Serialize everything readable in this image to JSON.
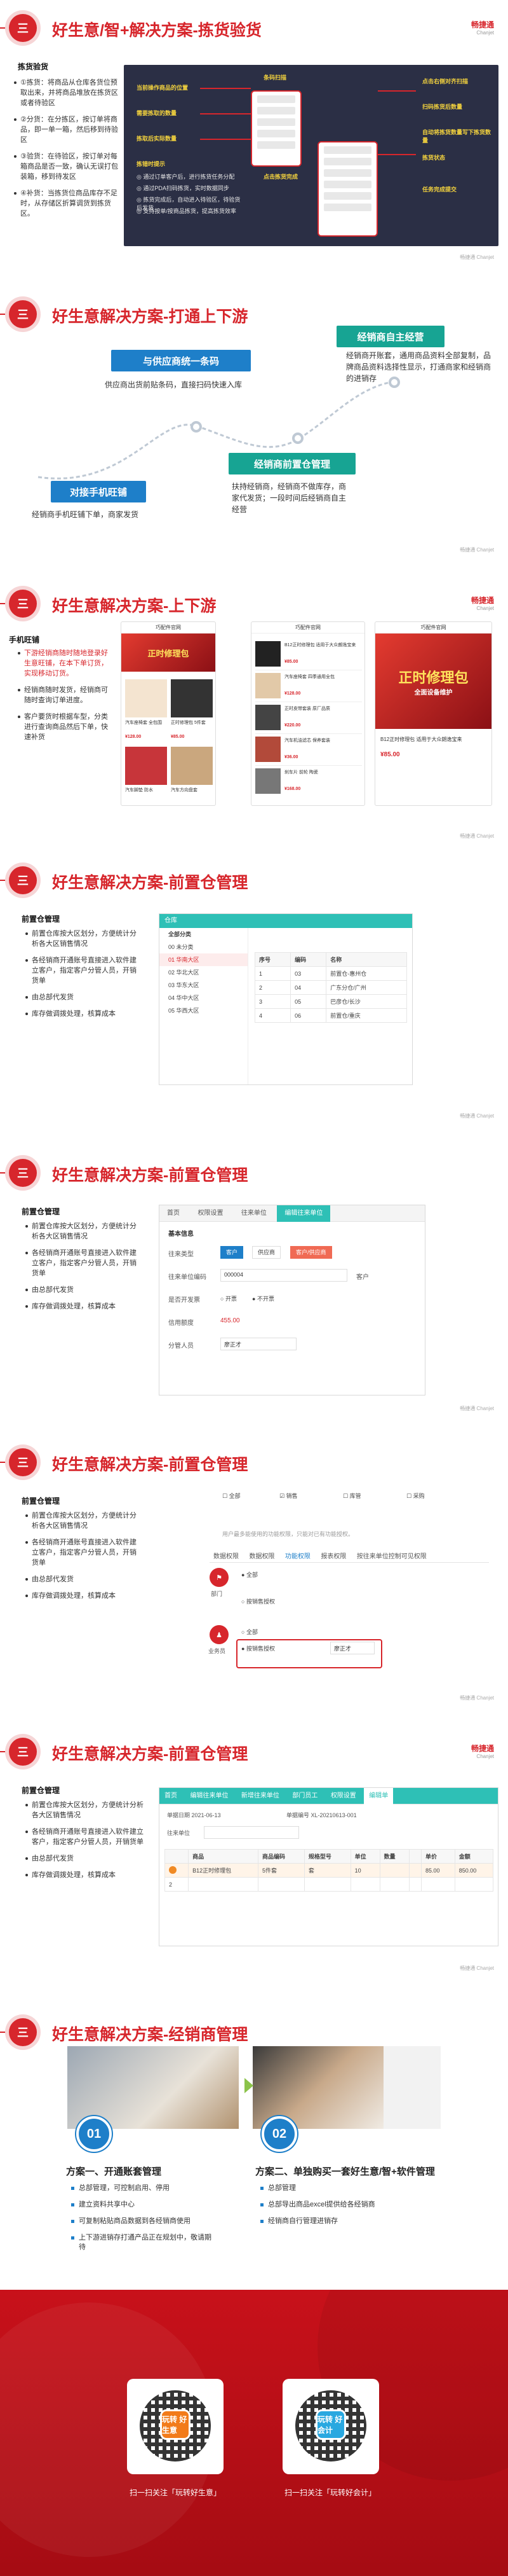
{
  "brand": {
    "cn": "畅捷通",
    "en": "Chanjet"
  },
  "footer": "畅捷通 Chanjet",
  "slide1": {
    "num": "三",
    "title": "好生意/智+解决方案-拣货验货",
    "section": "拣货验货",
    "steps": [
      "①拣货：将商品从仓库各货位预取出来，并将商品堆放在拣货区或者待验区",
      "②分货：在分拣区，按订单将商品，即一单一箱，然后移到待验区",
      "③验货：在待验区，按订单对每箱商品是否一致，确认无误打包装箱，移到待发区",
      "④补货：当拣货位商品库存不足时，从存储区折算调货到拣货区。"
    ],
    "notes": [
      "当前操作商品的位置",
      "需要拣取的数量",
      "拣取后实际数量",
      "拣错时提示",
      "条码扫描",
      "点击拣货完成",
      "点击右侧对齐扫描",
      "扫码拣货后数量",
      "自动将拣货数量写下拣货数量",
      "拣货状态",
      "任务完成提交"
    ],
    "board_paragraphs": [
      "◎ 通过订单客户后，进行拣货任务分配",
      "◎ 通过PDA扫码拣货，实时数据同步",
      "◎ 拣货完成后，自动进入待验区，待验货后发货",
      "◎ 支持按单/按商品拣货，提高拣货效率"
    ]
  },
  "slide2": {
    "num": "三",
    "title": "好生意解决方案-打通上下游",
    "badge_code": "与供应商统一条码",
    "desc_code": "供应商出货前贴条码，直接扫码快速入库",
    "badge_self": "经销商自主经营",
    "desc_self": "经销商开账套，通用商品资料全部复制，品牌商品资料选择性显示，打通商家和经销商的进销存",
    "badge_front": "经销商前置仓管理",
    "desc_front": "扶持经销商，经销商不做库存，商家代发货；一段时间后经销商自主经营",
    "badge_mobile": "对接手机旺铺",
    "desc_mobile": "经销商手机旺铺下单，商家发货"
  },
  "slide3": {
    "num": "三",
    "title": "好生意解决方案-上下游",
    "section": "手机旺铺",
    "red_bullet": "下游经销商随时随地登录好生意旺铺，在本下单订货，实现移动订货。",
    "bullets": [
      "经销商随时发货，经销商可随时查询订单进度。",
      "客户要货时根据车型，分类进行查询商品然后下单，快速补货"
    ],
    "phone_title": "巧配件官网",
    "banner_text": "正时修理包",
    "banner_sub": "全面设备维护",
    "products": [
      {
        "name": "汽车座椅套 全包围",
        "price": "¥128.00"
      },
      {
        "name": "正时修理包 5件套",
        "price": "¥85.00"
      },
      {
        "name": "汽车脚垫 防水",
        "price": "¥99.00"
      },
      {
        "name": "汽车方向盘套",
        "price": "¥45.00"
      }
    ],
    "list_items": [
      {
        "name": "B12正时修理包 适用于大众朗逸宝来",
        "price": "¥85.00"
      },
      {
        "name": "汽车座椅套 四季通用全包",
        "price": "¥128.00"
      },
      {
        "name": "正时皮带套装 原厂品质",
        "price": "¥220.00"
      },
      {
        "name": "汽车机油滤芯 保养套装",
        "price": "¥36.00"
      },
      {
        "name": "刹车片 前轮 陶瓷",
        "price": "¥168.00"
      }
    ]
  },
  "slide4": {
    "num": "三",
    "title": "好生意解决方案-前置仓管理",
    "section": "前置仓管理",
    "bullets": [
      "前置仓库按大区划分，方便统计分析各大区销售情况",
      "各经销商开通账号直接进入软件建立客户，指定客户分管人员，开销货单",
      "由总部代发货",
      "库存做调拨处理，核算成本"
    ],
    "tab_label": "仓库",
    "tree_root": "全部分类",
    "tree": [
      "00 未分类",
      "01 华南大区",
      "02 华北大区",
      "03 华东大区",
      "04 华中大区",
      "05 华西大区"
    ],
    "columns": [
      "序号",
      "编码",
      "名称"
    ],
    "rows": [
      [
        "1",
        "03",
        "前置仓-惠州仓"
      ],
      [
        "2",
        "04",
        "广东分仓/广州"
      ],
      [
        "3",
        "05",
        "巴彦仓/长沙"
      ],
      [
        "4",
        "06",
        "前置仓/重庆"
      ]
    ]
  },
  "slide5": {
    "num": "三",
    "title": "好生意解决方案-前置仓管理",
    "section": "前置仓管理",
    "bullets": [
      "前置仓库按大区划分，方便统计分析各大区销售情况",
      "各经销商开通账号直接进入软件建立客户，指定客户分管人员，开销货单",
      "由总部代发货",
      "库存做调拨处理，核算成本"
    ],
    "tabs": [
      "首页",
      "权限设置",
      "往来单位",
      "编辑往来单位"
    ],
    "panel_title": "基本信息",
    "f_type": "往来类型",
    "types": [
      "客户",
      "供应商",
      "客户/供应商"
    ],
    "f_code": "往来单位编码",
    "code_val": "000004",
    "f_tax": "是否开发票",
    "tax_opts": [
      "开票",
      "不开票"
    ],
    "f_limit": "信用额度",
    "limit_val": "455.00",
    "f_owner": "分管人员",
    "owner_val": "廖正才",
    "customer_label": "客户"
  },
  "slide6": {
    "num": "三",
    "title": "好生意解决方案-前置仓管理",
    "section": "前置仓管理",
    "bullets": [
      "前置仓库按大区划分，方便统计分析各大区销售情况",
      "各经销商开通账号直接进入软件建立客户，指定客户分管人员，开销货单",
      "由总部代发货",
      "库存做调拨处理，核算成本"
    ],
    "checks": [
      "全部",
      "销售",
      "库管",
      "采购"
    ],
    "hint": "用户最多能使用的功能权限，只能对已有功能授权。",
    "tabs": [
      "数据权限",
      "数据权限",
      "功能权限",
      "报表权限",
      "按往来单位控制可见权限"
    ],
    "dept_label": "部门",
    "all_label": "全部",
    "self_label": "按销售授权",
    "sales_label": "业务员",
    "all2_label": "全部",
    "self2_label": "按销售授权",
    "selected_label": "廖正才"
  },
  "slide7": {
    "num": "三",
    "title": "好生意解决方案-前置仓管理",
    "section": "前置仓管理",
    "bullets": [
      "前置仓库按大区划分，方便统计分析各大区销售情况",
      "各经销商开通账号直接进入软件建立客户，指定客户分管人员，开销货单",
      "由总部代发货",
      "库存做调拨处理，核算成本"
    ],
    "tabs": [
      "首页",
      "编辑往来单位",
      "新增往来单位",
      "部门员工",
      "权限设置",
      "编辑单"
    ],
    "date_label": "单据日期",
    "date_val": "2021-06-13",
    "no_label": "单据编号",
    "no_val": "XL-20210613-001",
    "customer_label": "往来单位",
    "columns": [
      "",
      "商品",
      "商品编码",
      "规格型号",
      "单位",
      "数量",
      "",
      "单价",
      "金额"
    ],
    "row1": [
      "1",
      "B12正时修理包",
      "5件套",
      "套",
      "10",
      "",
      "85.00",
      "850.00"
    ],
    "row2": [
      "2"
    ]
  },
  "slide8": {
    "num": "三",
    "title": "好生意解决方案-经销商管理",
    "plan1_num": "01",
    "plan1_title": "方案一、开通账套管理",
    "plan1": [
      "总部管理，可控制启用、停用",
      "建立资料共享中心",
      "可复制粘贴商品数据到各经销商使用",
      "上下游进销存打通产品正在规划中，敬请期待"
    ],
    "plan2_num": "02",
    "plan2_title": "方案二、单独购买一套好生意/智+软件管理",
    "plan2": [
      "总部管理",
      "总部导出商品excel提供给各经销商",
      "经销商自行管理进销存"
    ]
  },
  "bottom": {
    "qr1_logo": "玩转 好生意",
    "qr2_logo": "玩转 好会计",
    "scan1": "扫一扫关注「玩转好生意」",
    "scan2": "扫一扫关注「玩转好会计」"
  },
  "colors": {
    "brand_red": "#d7262c",
    "blue": "#1e7fc9",
    "teal": "#17a493"
  }
}
